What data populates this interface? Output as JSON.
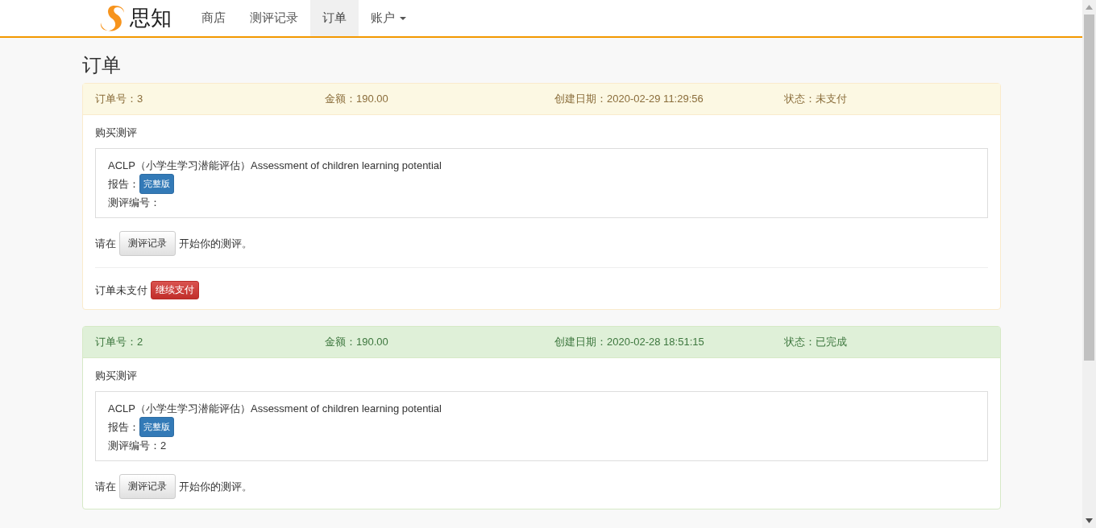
{
  "navbar": {
    "brand": "思知",
    "items": [
      {
        "label": "商店",
        "selected": false,
        "dropdown": false
      },
      {
        "label": "测评记录",
        "selected": false,
        "dropdown": false
      },
      {
        "label": "订单",
        "selected": true,
        "dropdown": false
      },
      {
        "label": "账户",
        "selected": false,
        "dropdown": true
      }
    ]
  },
  "page_title": "订单",
  "orders": [
    {
      "kind": "pending",
      "number": "订单号：3",
      "amount": "金额：190.00",
      "created": "创建日期：2020-02-29 11:29:56",
      "status": "状态：未支付",
      "section_title": "购买测评",
      "item": {
        "name": "ACLP（小学生学习潜能评估）Assessment of children learning potential",
        "report_label": "报告：",
        "report_badge": "完整版",
        "code": "测评编号："
      },
      "hint_before": "请在",
      "hint_button": "测评记录",
      "hint_after": "开始你的测评。",
      "payment": {
        "text": "订单未支付",
        "button": "继续支付"
      }
    },
    {
      "kind": "done",
      "number": "订单号：2",
      "amount": "金额：190.00",
      "created": "创建日期：2020-02-28 18:51:15",
      "status": "状态：已完成",
      "section_title": "购买测评",
      "item": {
        "name": "ACLP（小学生学习潜能评估）Assessment of children learning potential",
        "report_label": "报告：",
        "report_badge": "完整版",
        "code": "测评编号：2"
      },
      "hint_before": "请在",
      "hint_button": "测评记录",
      "hint_after": "开始你的测评。"
    }
  ]
}
